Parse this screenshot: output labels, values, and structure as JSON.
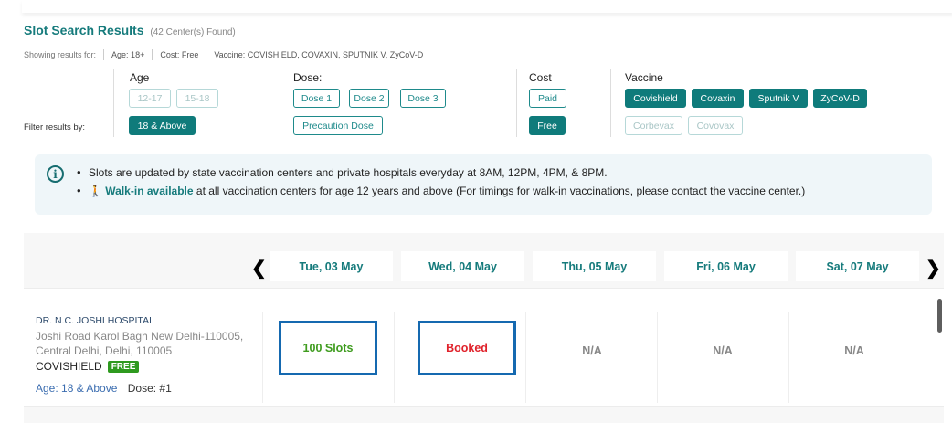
{
  "header": {
    "title": "Slot Search Results",
    "count": "(42 Center(s) Found)",
    "showing_label": "Showing results for:",
    "age": "Age: 18+",
    "cost": "Cost: Free",
    "vaccine": "Vaccine: COVISHIELD, COVAXIN, SPUTNIK V, ZyCoV-D"
  },
  "filters": {
    "label": "Filter results by:",
    "age": {
      "title": "Age",
      "options": [
        "12-17",
        "15-18",
        "18 & Above"
      ]
    },
    "dose": {
      "title": "Dose:",
      "options": [
        "Dose 1",
        "Dose 2",
        "Dose 3",
        "Precaution Dose"
      ]
    },
    "cost": {
      "title": "Cost",
      "options": [
        "Paid",
        "Free"
      ]
    },
    "vaccine": {
      "title": "Vaccine",
      "options": [
        "Covishield",
        "Covaxin",
        "Sputnik V",
        "ZyCoV-D",
        "Corbevax",
        "Covovax"
      ]
    }
  },
  "info": {
    "icon": "info-icon",
    "line1": "Slots are updated by state vaccination centers and private hospitals everyday at 8AM, 12PM, 4PM, & 8PM.",
    "walkin_icon": "🚶",
    "walkin_label": "Walk-in available",
    "line2_rest": " at all vaccination centers for age 12 years and above (For timings for walk-in vaccinations, please contact the vaccine center.)"
  },
  "calendar": {
    "prev": "❮",
    "next": "❯",
    "days": [
      "Tue, 03 May",
      "Wed, 04 May",
      "Thu, 05 May",
      "Fri, 06 May",
      "Sat, 07 May"
    ]
  },
  "center": {
    "name": "DR. N.C. JOSHI HOSPITAL",
    "address": "Joshi Road Karol Bagh New Delhi-110005, Central Delhi, Delhi, 110005",
    "vaccine": "COVISHIELD",
    "fee": "FREE",
    "age": "Age: 18 & Above",
    "dose": "Dose: #1",
    "slots": [
      "100 Slots",
      "Booked",
      "N/A",
      "N/A",
      "N/A"
    ]
  },
  "colors": {
    "accent": "#167b7c",
    "chip_filled": "#0f7b7b",
    "available": "#3f9c1f",
    "booked": "#e0222b",
    "highlight_border": "#1569b0"
  }
}
